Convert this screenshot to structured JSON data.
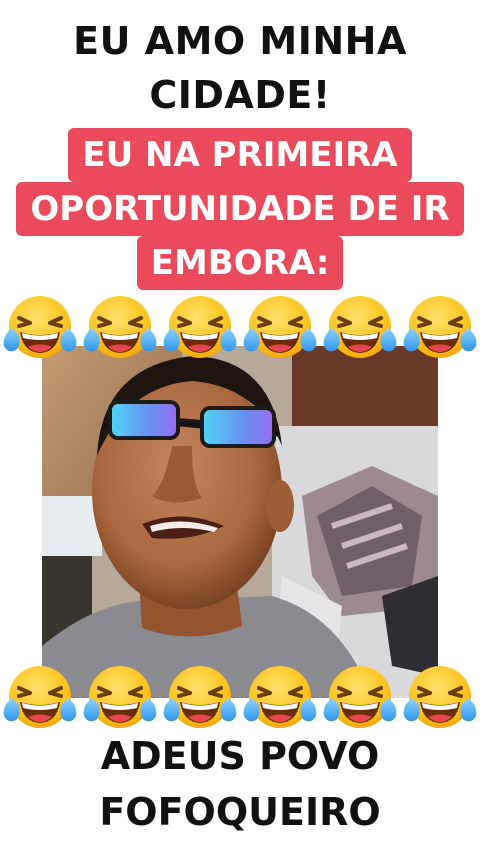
{
  "captions": {
    "top_lines": [
      "EU AMO MINHA",
      "CIDADE!"
    ],
    "highlight_lines": [
      "EU NA PRIMEIRA",
      "OPORTUNIDADE DE IR",
      "EMBORA:"
    ],
    "bottom_lines": [
      "ADEUS POVO",
      "FOFOQUEIRO"
    ]
  },
  "emoji": {
    "name": "face-with-tears-of-joy-icon",
    "top_count": 6,
    "bottom_count": 6
  },
  "colors": {
    "highlight_background": "#ea4a5c",
    "caption_text": "#111111",
    "highlight_text": "#ffffff"
  },
  "video": {
    "subject": "man-with-blue-tinted-glasses-photo"
  }
}
